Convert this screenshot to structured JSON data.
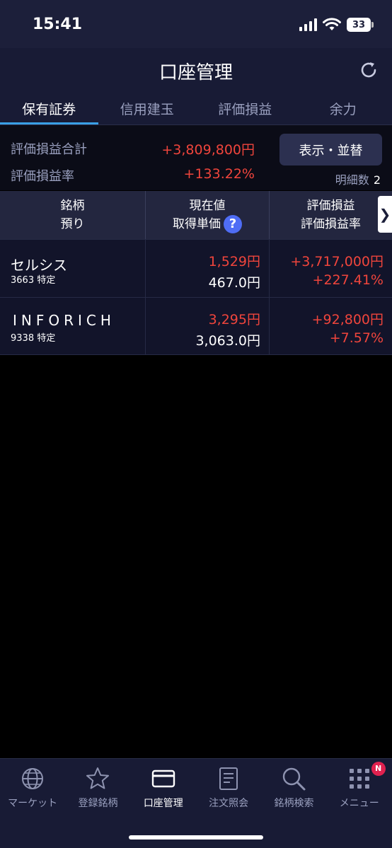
{
  "status": {
    "time": "15:41",
    "battery": "33"
  },
  "header": {
    "title": "口座管理"
  },
  "tabs": [
    {
      "label": "保有証券"
    },
    {
      "label": "信用建玉"
    },
    {
      "label": "評価損益"
    },
    {
      "label": "余力"
    }
  ],
  "summary": {
    "pl_total_label": "評価損益合計",
    "pl_total_value": "+3,809,800円",
    "pl_rate_label": "評価損益率",
    "pl_rate_value": "+133.22%",
    "sort_button": "表示・並替",
    "detail_label": "明細数",
    "detail_count": "2"
  },
  "table": {
    "headers": {
      "c1_l1": "銘柄",
      "c1_l2": "預り",
      "c2_l1": "現在値",
      "c2_l2": "取得単価",
      "help": "?",
      "c3_l1": "評価損益",
      "c3_l2": "評価損益率"
    },
    "scroll_glyph": "❯",
    "rows": [
      {
        "name": "セルシス",
        "code": "3663 特定",
        "price": "1,529円",
        "cost": "467.0円",
        "pl": "+3,717,000円",
        "pl_rate": "+227.41%"
      },
      {
        "name": "INFORICH",
        "code": "9338 特定",
        "price": "3,295円",
        "cost": "3,063.0円",
        "pl": "+92,800円",
        "pl_rate": "+7.57%"
      }
    ]
  },
  "nav": [
    {
      "label": "マーケット",
      "icon": "globe-icon"
    },
    {
      "label": "登録銘柄",
      "icon": "star-icon"
    },
    {
      "label": "口座管理",
      "icon": "card-icon"
    },
    {
      "label": "注文照会",
      "icon": "document-icon"
    },
    {
      "label": "銘柄検索",
      "icon": "search-icon"
    },
    {
      "label": "メニュー",
      "icon": "grid-icon",
      "badge": "N"
    }
  ],
  "colors": {
    "positive": "#f0453c",
    "accent": "#3aa0e6",
    "navy": "#181b35"
  }
}
